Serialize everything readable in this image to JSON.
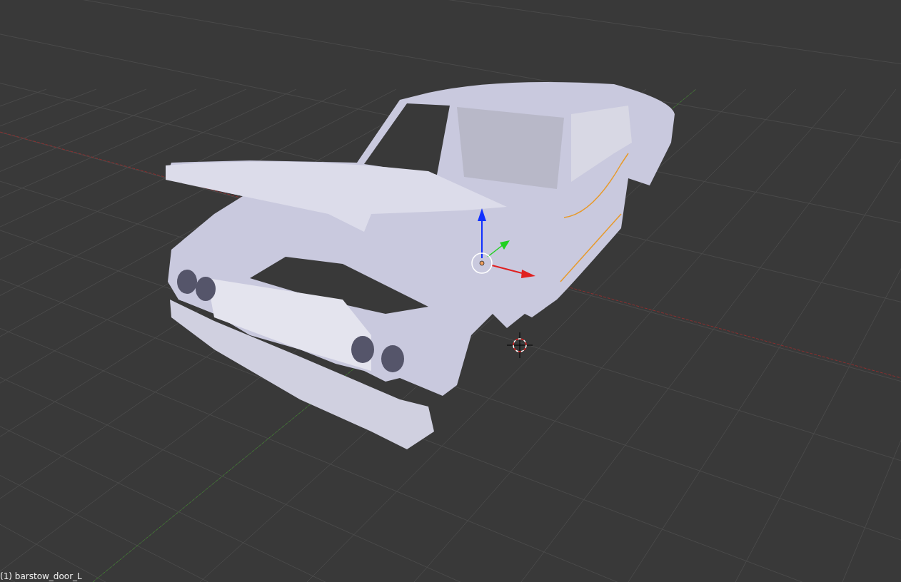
{
  "viewport": {
    "object_label": "(1) barstow_door_L"
  }
}
